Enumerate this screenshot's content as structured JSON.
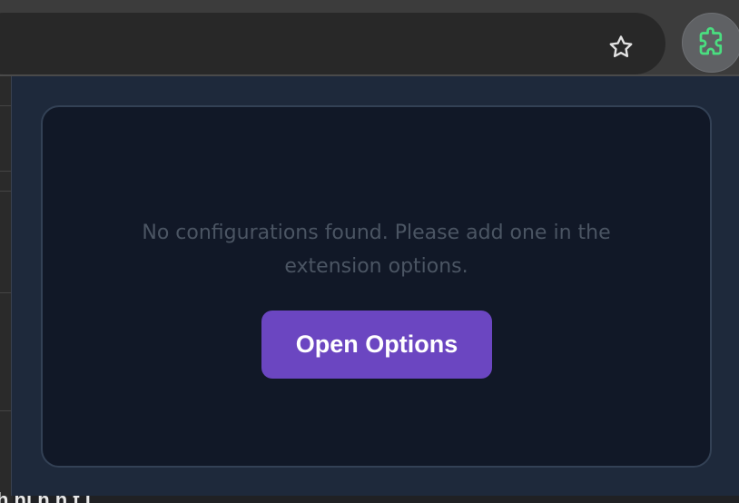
{
  "browser": {
    "bookmark_icon": "star-outline-icon",
    "extension_icon": "puzzle-piece-icon",
    "extension_icon_color": "#4ade80"
  },
  "background_page": {
    "partial_text": "h  hl     h    h    t    i"
  },
  "popup": {
    "empty_message": "No configurations found. Please add one in the extension options.",
    "open_options_label": "Open Options",
    "colors": {
      "popup_bg": "#1e293b",
      "card_bg": "#111827",
      "card_border": "#334155",
      "button_bg": "#6b46c1",
      "message_text": "#4b5563"
    }
  }
}
